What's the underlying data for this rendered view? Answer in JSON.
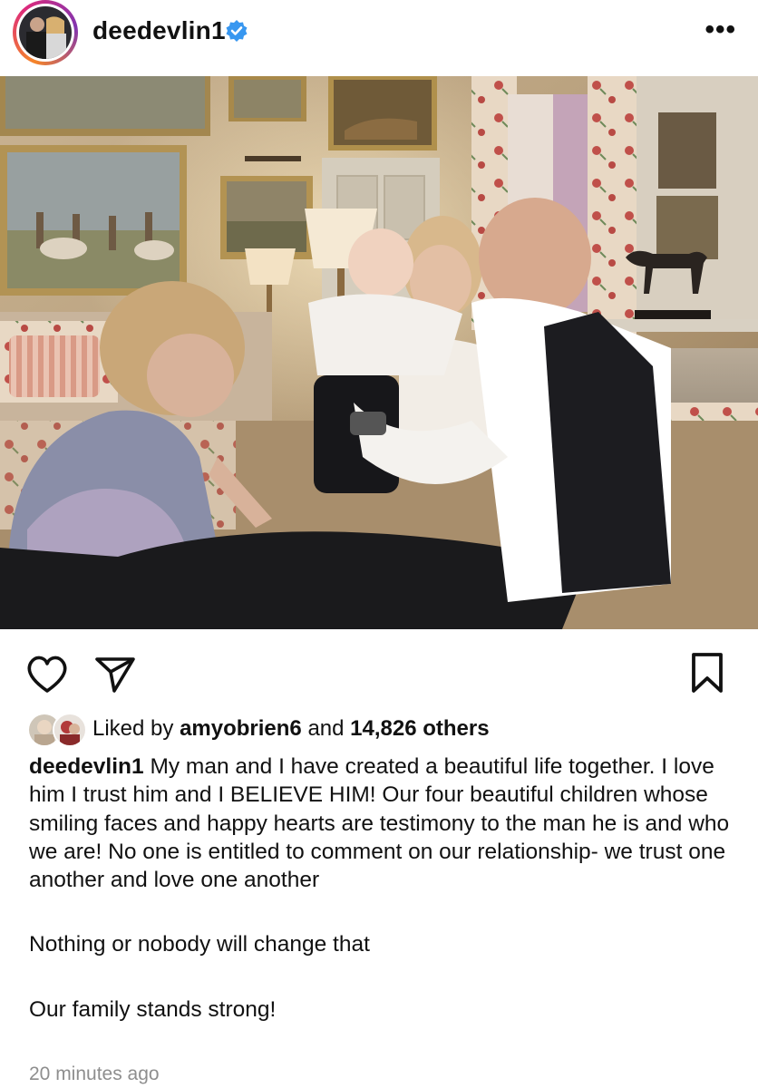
{
  "header": {
    "username": "deedevlin1",
    "verified_icon": "verified-badge-icon",
    "more_icon": "more-options-icon",
    "more_label": "•••"
  },
  "post": {
    "image_alt": "Family photo in a decorated sitting room",
    "actions": {
      "like_icon": "heart-icon",
      "share_icon": "send-icon",
      "save_icon": "bookmark-icon"
    },
    "likes": {
      "prefix": "Liked by ",
      "user": "amyobrien6",
      "middle": " and ",
      "count": "14,826 others"
    },
    "caption": {
      "user": "deedevlin1",
      "line1": " My man and I have created a beautiful life together. I love him I trust him and I BELIEVE HIM! Our four beautiful children whose smiling faces and happy hearts are testimony to the man he is and who we are! No one is entitled to comment on our relationship- we trust one another and love one another",
      "line2": "Nothing or nobody will change that",
      "line3": "Our family stands strong!"
    },
    "timestamp": "20 minutes ago"
  },
  "colors": {
    "text": "#111111",
    "muted": "#8e8e8e",
    "verified": "#3897f0"
  }
}
